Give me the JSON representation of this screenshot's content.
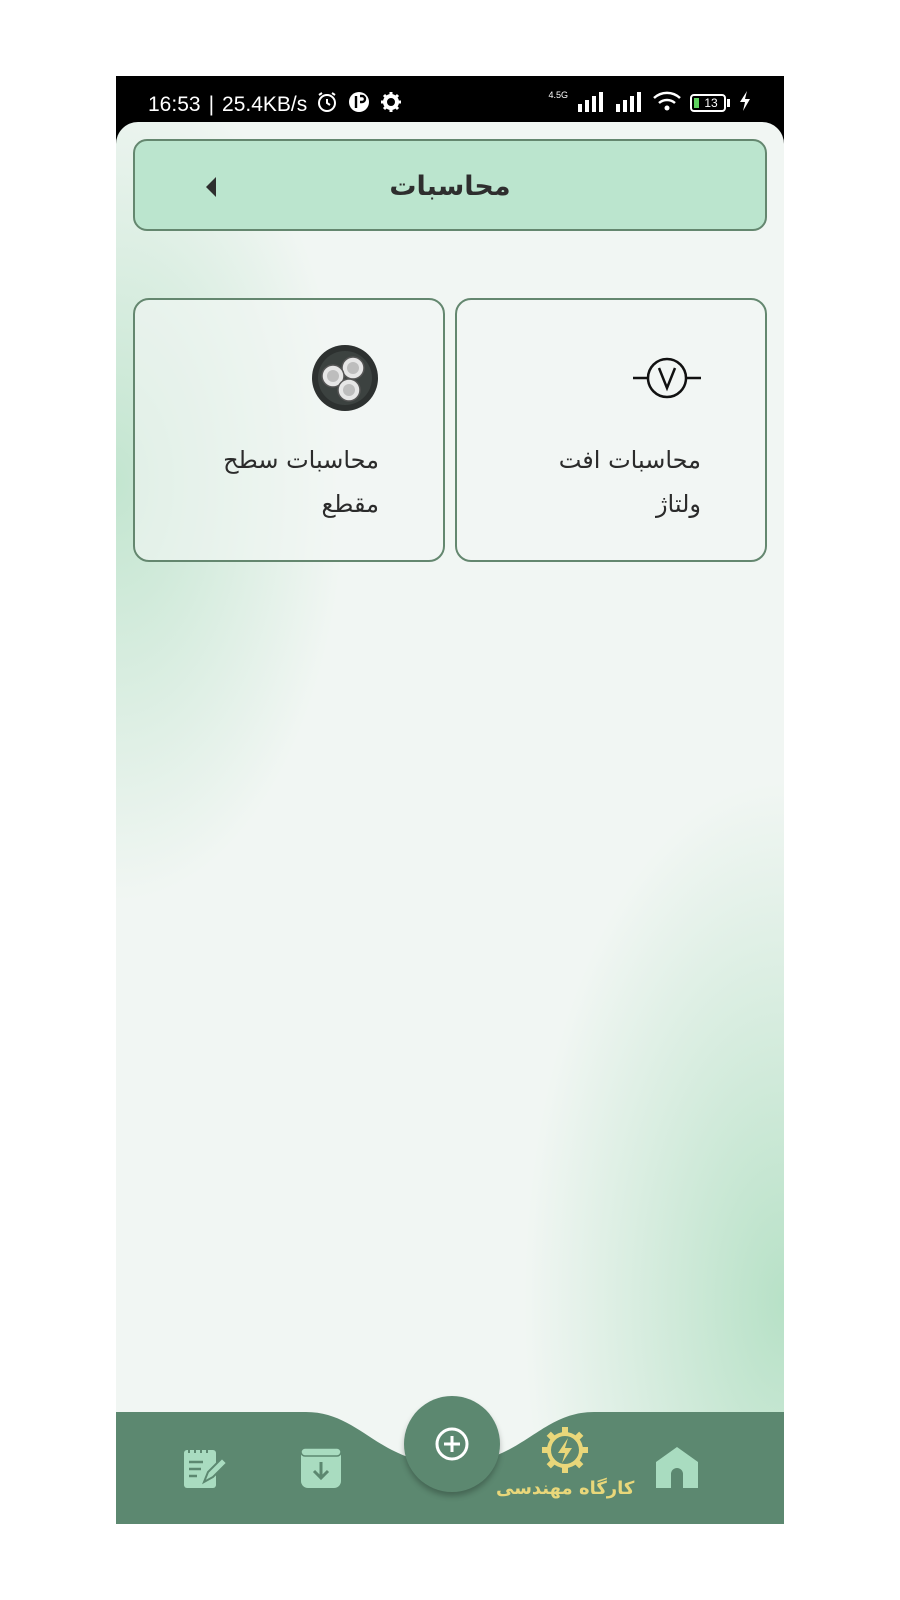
{
  "status_bar": {
    "time": "16:53",
    "separator": "|",
    "speed": "25.4KB/s",
    "network_type": "4.5G",
    "battery": "13",
    "icons": [
      "alarm-icon",
      "app-notification-icon",
      "settings-icon",
      "signal-icon",
      "wifi-icon",
      "battery-icon",
      "charging-icon"
    ]
  },
  "header": {
    "title": "محاسبات",
    "back_icon": "caret-left-icon"
  },
  "cards": [
    {
      "label_line1": "محاسبات افت",
      "label_line2": "ولتاژ",
      "icon": "voltmeter-icon"
    },
    {
      "label_line1": "محاسبات سطح",
      "label_line2": "مقطع",
      "icon": "cable-cross-section-icon"
    }
  ],
  "bottom_nav": {
    "fab_icon": "add-circle-icon",
    "items": [
      {
        "icon": "notes-icon"
      },
      {
        "icon": "archive-download-icon"
      },
      {
        "icon": "gear-lightning-icon",
        "label": "کارگاه مهندسی"
      },
      {
        "icon": "home-icon"
      }
    ]
  },
  "colors": {
    "accent": "#5c8870",
    "header_bg": "#bbe5ce",
    "border": "#64876f",
    "active_label": "#e9d77a",
    "background": "#f1f6f3"
  }
}
